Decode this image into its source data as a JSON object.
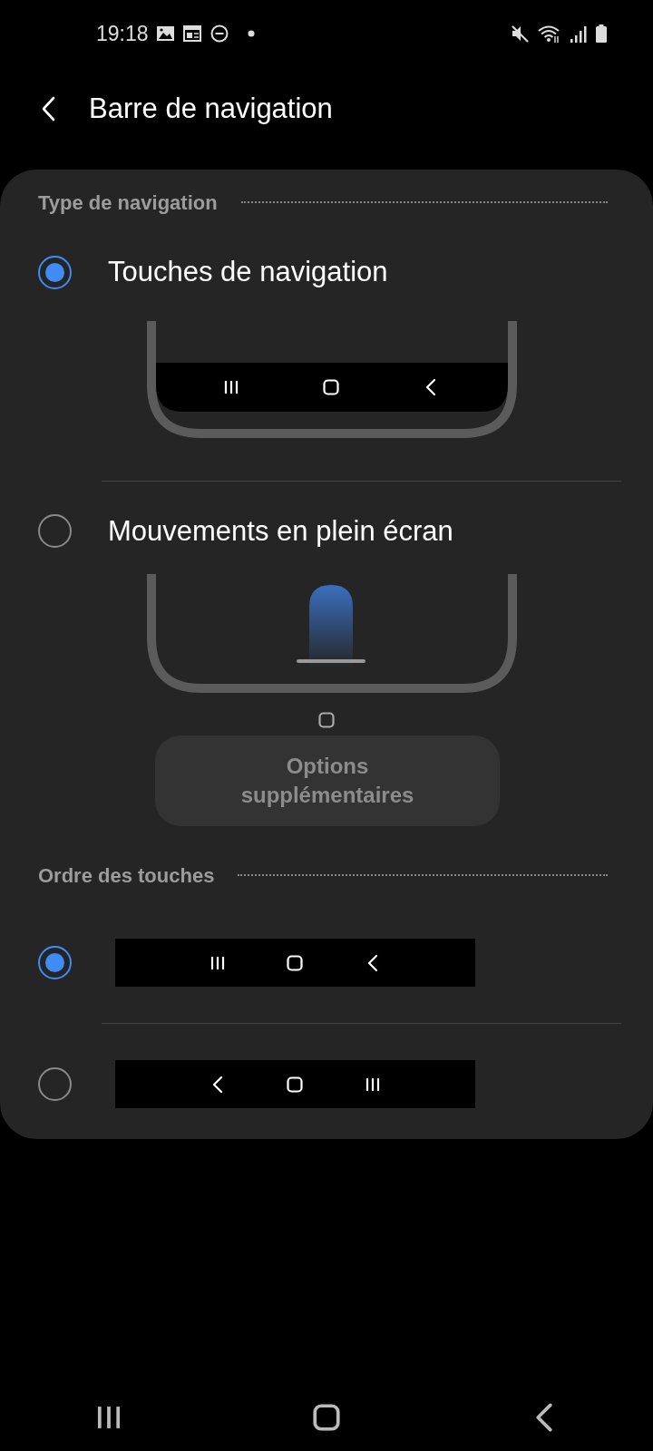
{
  "status_bar": {
    "time": "19:18"
  },
  "title": "Barre de navigation",
  "sections": [
    {
      "title": "Type de navigation",
      "options": [
        {
          "kind": "buttons",
          "label": "Touches de navigation",
          "selected": true
        },
        {
          "kind": "gestures",
          "label": "Mouvements en plein écran",
          "selected": false
        }
      ],
      "button": {
        "label": "Options supplémentaires",
        "disabled": true
      }
    },
    {
      "title": "Ordre des touches",
      "options": [
        {
          "kind": "order",
          "selected": true,
          "keys": [
            {
              "kind": "recents"
            },
            {
              "kind": "home"
            },
            {
              "kind": "back"
            }
          ]
        },
        {
          "kind": "order",
          "selected": false,
          "keys": [
            {
              "kind": "back"
            },
            {
              "kind": "home"
            },
            {
              "kind": "recents"
            }
          ]
        }
      ]
    }
  ]
}
